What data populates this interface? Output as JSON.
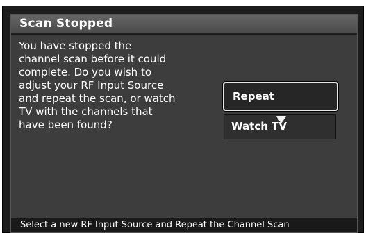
{
  "dialog": {
    "title": "Scan Stopped",
    "message_lines": [
      "You have stopped the",
      "channel scan before it could",
      "complete. Do you wish to",
      "adjust your RF Input Source",
      "and repeat the scan, or watch",
      "TV with the channels that",
      "have been found?"
    ],
    "buttons": {
      "repeat_label": "Repeat",
      "watch_label": "Watch TV"
    },
    "status": "Select a new RF Input Source and Repeat the Channel Scan",
    "cursor_icon": "triangle-down-icon"
  }
}
